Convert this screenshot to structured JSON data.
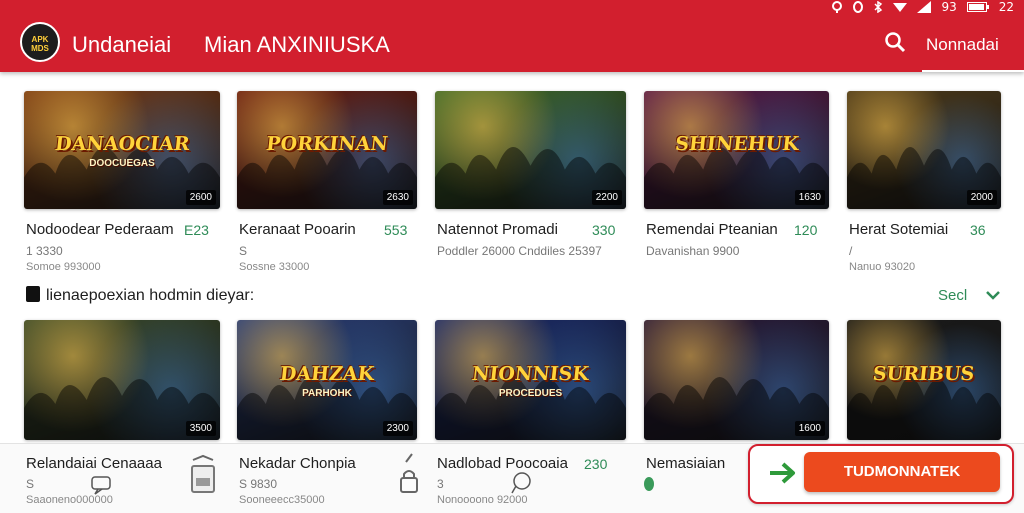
{
  "status_bar": {
    "icons": [
      "location-icon",
      "alarm-icon",
      "bluetooth-icon",
      "wifi-icon",
      "signal-icon"
    ],
    "battery": "93",
    "time": "22"
  },
  "header": {
    "logo_text": "APK MDS",
    "title1": "Undaneiai",
    "title2": "Mian ANXINIUSKA",
    "account_label": "Nonnadai"
  },
  "row1": [
    {
      "art_title": "DANAOCIAR",
      "art_sub": "DOOCUEGAS",
      "count": "2600",
      "name": "Nodoodear Pederaam",
      "price": "E23",
      "meta1": "1    3330",
      "meta2": "Somoe 993000",
      "bg": "#7a3b14"
    },
    {
      "art_title": "PORKINAN",
      "art_sub": "",
      "count": "2630",
      "name": "Keranaat Pooarin",
      "price": "553",
      "meta1": "S",
      "meta2": "Sossne 33000",
      "bg": "#6b1f14"
    },
    {
      "art_title": "",
      "art_sub": "",
      "count": "2200",
      "name": "Natennot Promadi",
      "price": "330",
      "meta1": "Poddler 26000   Cnddiles 25397",
      "meta2": "",
      "bg": "#3f6b2a"
    },
    {
      "art_title": "SHINEHUK",
      "art_sub": "",
      "count": "1630",
      "name": "Remendai Pteanian",
      "price": "120",
      "meta1": "Davanishan 9900",
      "meta2": "",
      "bg": "#5a1a4a"
    },
    {
      "art_title": "",
      "art_sub": "",
      "count": "2000",
      "name": "Herat Sotemiai",
      "price": "36",
      "meta1": "/",
      "meta2": "Nanuo 93020",
      "bg": "#4d3a1a"
    }
  ],
  "section": {
    "label": "lienaepoexian hodmin dieyar:",
    "see_all": "Secl"
  },
  "row2": [
    {
      "art_title": "",
      "art_sub": "",
      "count": "3500",
      "name": "Relandaiai Cenaaaa",
      "meta1": "S",
      "meta2": "Saaoneno000000",
      "bg": "#3a4a2a"
    },
    {
      "art_title": "DAHZAK",
      "art_sub": "PARHOHK",
      "count": "2300",
      "name": "Nekadar Chonpia",
      "meta1": "S   9830",
      "meta2": "Sooneeecc35000",
      "bg": "#2a3f7a"
    },
    {
      "art_title": "NIONNISK",
      "art_sub": "PROCEDUES",
      "count": "",
      "name": "Nadlobad Poocoaia",
      "price": "230",
      "meta1": "3",
      "meta2": "Nonoooono 92000",
      "bg": "#1a2a6b"
    },
    {
      "art_title": "",
      "art_sub": "",
      "count": "1600",
      "name": "Nemasiaian",
      "meta1": "",
      "meta2": "",
      "bg": "#2a1a3a"
    },
    {
      "art_title": "SURIBUS",
      "art_sub": "",
      "count": "",
      "name": "",
      "meta1": "",
      "meta2": "",
      "bg": "#1a1a1a"
    }
  ],
  "cta": {
    "label": "TUDMONNATEK"
  }
}
